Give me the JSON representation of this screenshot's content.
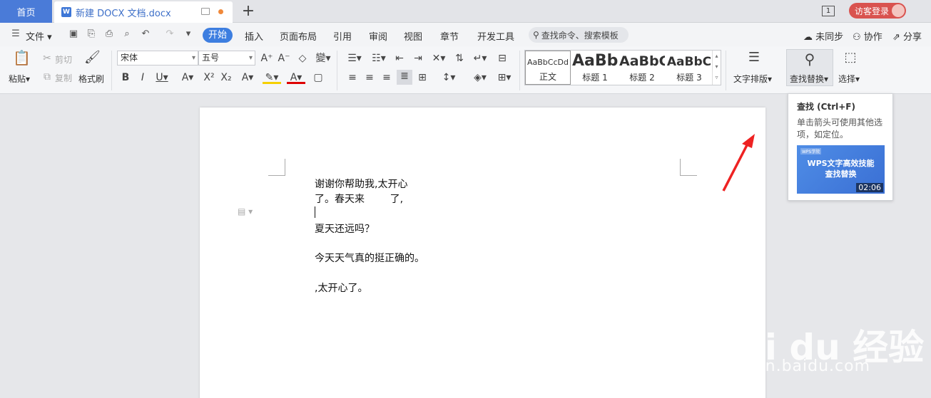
{
  "tabs": {
    "home": "首页",
    "doc_title": "新建 DOCX 文档.docx",
    "add": "+",
    "window_count": "1",
    "login": "访客登录"
  },
  "menu": {
    "file": "文件",
    "items": [
      "开始",
      "插入",
      "页面布局",
      "引用",
      "审阅",
      "视图",
      "章节",
      "开发工具"
    ],
    "search_placeholder": "查找命令、搜索模板",
    "sync": "未同步",
    "collab": "协作",
    "share": "分享"
  },
  "ribbon": {
    "paste": "粘贴",
    "cut": "剪切",
    "copy": "复制",
    "format_painter": "格式刷",
    "font_name": "宋体",
    "font_size": "五号",
    "styles": [
      {
        "preview": "AaBbCcDd",
        "label": "正文"
      },
      {
        "preview": "AaBb",
        "label": "标题 1"
      },
      {
        "preview": "AaBbC",
        "label": "标题 2"
      },
      {
        "preview": "AaBbC",
        "label": "标题 3"
      }
    ],
    "text_layout": "文字排版",
    "find_replace": "查找替换",
    "select": "选择"
  },
  "tooltip": {
    "title": "查找 (Ctrl+F)",
    "desc": "单击箭头可使用其他选项，如定位。",
    "video_brand": "WPS学院",
    "video_title": "WPS文字高效技能\n查找替换",
    "video_duration": "02:06"
  },
  "document": {
    "lines": [
      "谢谢你帮助我,太开心",
      "了。春天来        了,",
      "",
      "夏天还远吗？",
      "",
      "今天天气真的挺正确的。",
      "",
      ",太开心了。"
    ]
  },
  "watermark": {
    "main": "Bai du 经验",
    "sub": "jingyan.baidu.com"
  },
  "colors": {
    "accent": "#3d7ee0",
    "home_tab": "#4a7bd8",
    "login": "#d9534f",
    "arrow": "#ee2222"
  }
}
